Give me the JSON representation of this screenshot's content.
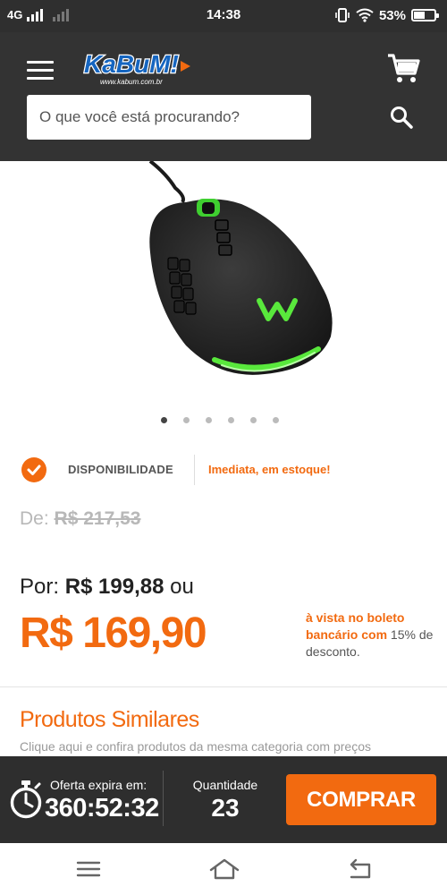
{
  "status_bar": {
    "network": "4G",
    "time": "14:38",
    "battery_percent": "53%",
    "battery_level": 0.53
  },
  "header": {
    "logo_text": "KaBuM!",
    "logo_url_text": "www.kabum.com.br",
    "search_placeholder": "O que você está procurando?",
    "icons": {
      "menu": "menu-icon",
      "cart": "cart-icon",
      "search": "search-icon"
    }
  },
  "product": {
    "image": "gaming-mouse-image",
    "gallery": {
      "count": 6,
      "active_index": 0
    },
    "availability": {
      "label": "DISPONIBILIDADE",
      "value": "Imediata, em estoque!"
    },
    "price": {
      "from_prefix": "De:",
      "from_value": "R$ 217,53",
      "por_prefix": "Por:",
      "por_value": "R$ 199,88",
      "por_suffix": "ou",
      "main": "R$ 169,90",
      "note_highlight": "à vista no boleto bancário com",
      "note_percent": "15%",
      "note_rest": "de desconto."
    }
  },
  "similar": {
    "title": "Produtos Similares",
    "subtitle": "Clique aqui e confira produtos da mesma categoria com preços"
  },
  "buy_bar": {
    "offer_label": "Oferta expira em:",
    "offer_time": "360:52:32",
    "qty_label": "Quantidade",
    "qty_value": "23",
    "buy_label": "COMPRAR"
  },
  "nav_bar": {
    "icons": [
      "menu-lines-icon",
      "home-icon",
      "back-icon"
    ]
  },
  "colors": {
    "brand_orange": "#f26a10",
    "header_dark": "#333333",
    "logo_blue": "#1565c0"
  }
}
